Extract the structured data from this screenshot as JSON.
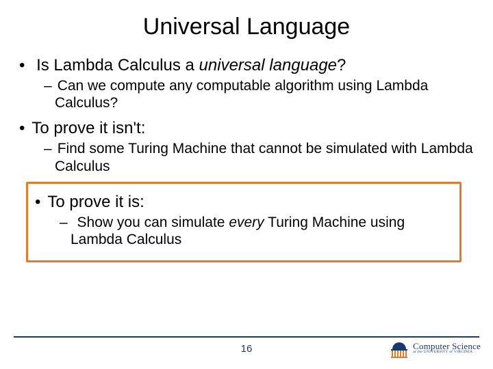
{
  "title": "Universal Language",
  "bullets": {
    "b1_pre": "Is Lambda Calculus a ",
    "b1_ital": "universal language",
    "b1_post": "?",
    "s1": "Can we compute any computable algorithm using Lambda Calculus?",
    "b2": "To prove it isn't:",
    "s2": "Find some Turing Machine that cannot be simulated with Lambda Calculus",
    "b3": "To prove it is:",
    "s3_pre": "Show you can simulate ",
    "s3_ital": "every",
    "s3_post": " Turing Machine using Lambda Calculus"
  },
  "footer": {
    "page": "16",
    "logo_main": "Computer Science",
    "logo_sub": "at the UNIVERSITY of VIRGINIA"
  }
}
